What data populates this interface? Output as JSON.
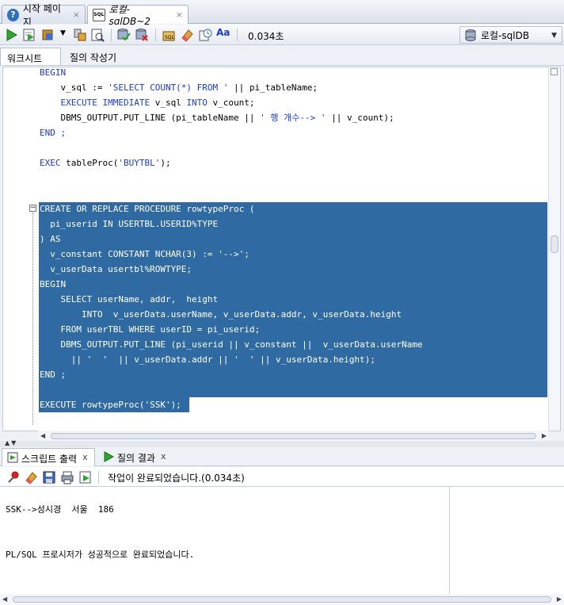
{
  "doc_tabs": [
    {
      "label": "시작 페이지",
      "icon": "help-icon"
    },
    {
      "label": "로컬-sqlDB~2",
      "icon": "sql-file-icon"
    }
  ],
  "toolbar": {
    "exec_time": "0.034초",
    "connection": "로컬-sqlDB"
  },
  "sub_tabs": {
    "worksheet": "워크시트",
    "query_builder": "질의 작성기"
  },
  "code": {
    "l1": "BEGIN",
    "l2a": "    v_sql := ",
    "l2b": "'SELECT COUNT(*) FROM '",
    "l2c": " || pi_tableName;",
    "l3a": "    EXECUTE IMMEDIATE",
    "l3b": " v_sql ",
    "l3c": "INTO",
    "l3d": " v_count;",
    "l4a": "    DBMS_OUTPUT.PUT_LINE (pi_tableName || ",
    "l4b": "' 행 개수--> '",
    "l4c": " || v_count);",
    "l5": "END ;",
    "l6a": "EXEC",
    "l6b": " tableProc(",
    "l6c": "'BUYTBL'",
    "l6d": ");",
    "l7": "CREATE OR REPLACE PROCEDURE rowtypeProc (",
    "l8": "  pi_userid IN USERTBL.USERID%TYPE",
    "l9": ") AS",
    "l10": "  v_constant CONSTANT NCHAR(3) := '-->';",
    "l11": "  v_userData usertbl%ROWTYPE;",
    "l12": "BEGIN",
    "l13": "    SELECT userName, addr,  height",
    "l14": "        INTO  v_userData.userName, v_userData.addr, v_userData.height",
    "l15": "    FROM userTBL WHERE userID = pi_userid;",
    "l16": "    DBMS_OUTPUT.PUT_LINE (pi_userid || v_constant ||  v_userData.userName",
    "l17": "      || '  '  || v_userData.addr || '  ' || v_userData.height);",
    "l18": "END ;",
    "l19": "EXECUTE rowtypeProc('SSK');"
  },
  "output": {
    "tab_script": "스크립트 출력",
    "tab_query": "질의 결과",
    "status": "작업이 완료되었습니다.(0.034초)",
    "line1": "SSK-->성시경  서울  186",
    "line2": "PL/SQL 프로시저가 성공적으로 완료되었습니다."
  }
}
